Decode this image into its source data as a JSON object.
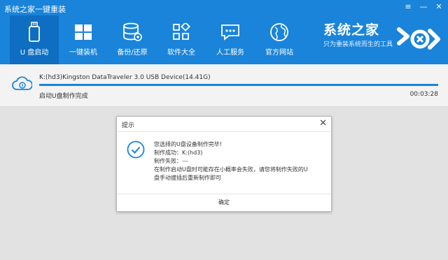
{
  "app": {
    "title": "系统之家一键重装"
  },
  "window_controls": {
    "menu": "≡",
    "minimize": "—",
    "close": "✕"
  },
  "nav": {
    "items": [
      {
        "label": "U 盘启动",
        "icon": "usb-drive-icon"
      },
      {
        "label": "一键装机",
        "icon": "windows-logo-icon"
      },
      {
        "label": "备份/还原",
        "icon": "database-icon"
      },
      {
        "label": "软件大全",
        "icon": "apps-grid-icon"
      },
      {
        "label": "人工服务",
        "icon": "chat-bubble-icon"
      },
      {
        "label": "官方网站",
        "icon": "globe-icon"
      }
    ],
    "active_index": 0
  },
  "brand": {
    "name": "系统之家",
    "slogan": "只为重装系统而生的工具",
    "logo_icon": "brand-logo-icon"
  },
  "device": {
    "name": "K:(hd3)Kingston DataTraveler 3.0 USB Device(14.41G)",
    "status": "启动U盘制作完成",
    "elapsed": "00:03:28",
    "progress": 1.0,
    "icon": "cloud-usb-icon"
  },
  "dialog": {
    "title": "提示",
    "close": "✕",
    "icon": "check-circle-icon",
    "messages": {
      "line1": "您选择的U盘设备制作完毕!",
      "line2": "制作成功：K:(hd3)",
      "line3": "制作失败：---",
      "line4": "在制作启动U盘时可能存在小概率会失败，请您将制作失败的U",
      "line5": "盘手动拔插后重新制作即可"
    },
    "ok_label": "确定"
  },
  "colors": {
    "header": "#1a84da",
    "active_tab": "#0e6ec2",
    "progress": "#1a84da"
  }
}
